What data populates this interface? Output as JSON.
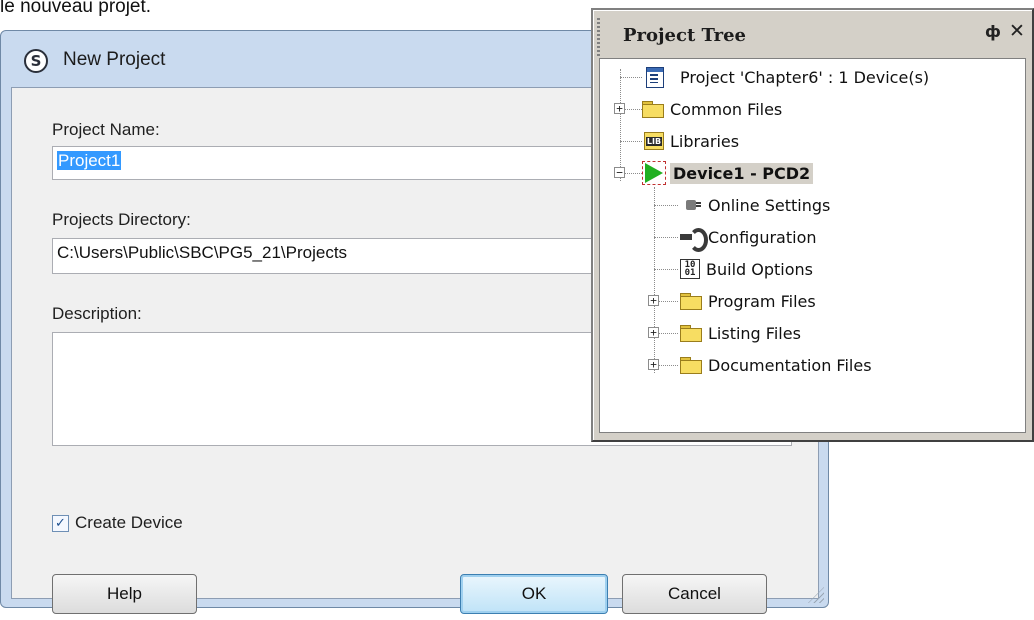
{
  "caption": "le nouveau projet.",
  "dialog": {
    "title": "New Project",
    "project_name_label": "Project Name:",
    "project_name_value": "Project1",
    "projects_directory_label": "Projects Directory:",
    "projects_directory_value": "C:\\Users\\Public\\SBC\\PG5_21\\Projects",
    "description_label": "Description:",
    "description_value": "",
    "create_device_label": "Create Device",
    "create_device_checked": true,
    "buttons": {
      "help": "Help",
      "ok": "OK",
      "cancel": "Cancel"
    }
  },
  "tree_panel": {
    "title": "Project Tree",
    "pin_glyph": "$",
    "close_glyph": "✕",
    "nodes": {
      "project": "Project 'Chapter6' : 1 Device(s)",
      "common_files": "Common Files",
      "libraries": "Libraries",
      "lib_icon_text": "LIB",
      "device": "Device1 - PCD2",
      "online_settings": "Online Settings",
      "configuration": "Configuration",
      "build_options": "Build Options",
      "program_files": "Program Files",
      "listing_files": "Listing Files",
      "documentation_files": "Documentation Files"
    }
  }
}
